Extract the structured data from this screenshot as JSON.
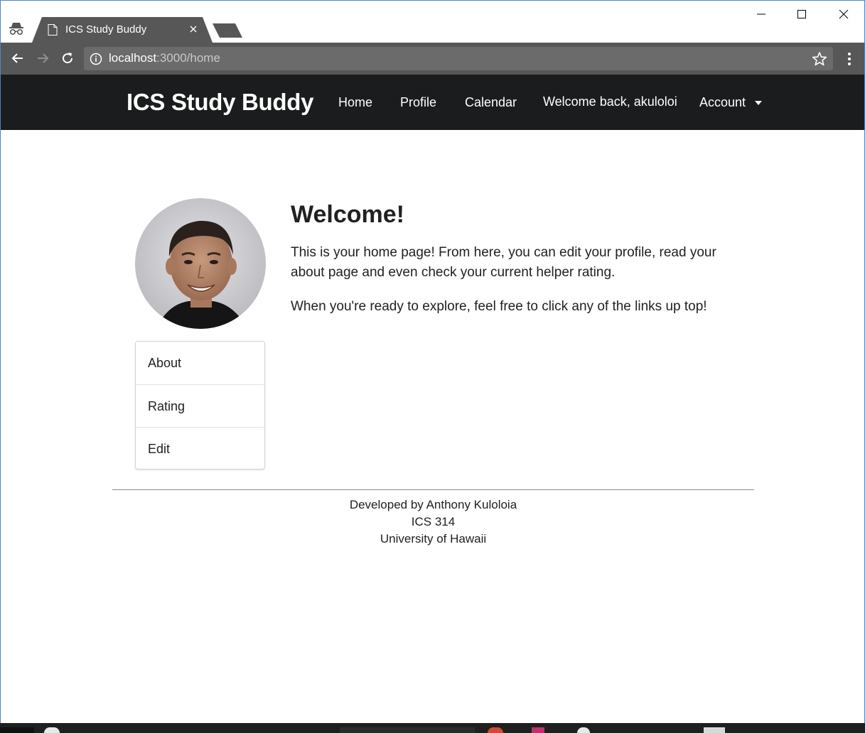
{
  "browser": {
    "tab_title": "ICS Study Buddy",
    "url_host": "localhost",
    "url_path": ":3000/home"
  },
  "navbar": {
    "brand": "ICS Study Buddy",
    "links": [
      "Home",
      "Profile",
      "Calendar",
      "Welcome back, akuloloi",
      "Account"
    ]
  },
  "main": {
    "heading": "Welcome!",
    "paragraph1": "This is your home page! From here, you can edit your profile, read your about page and even check your current helper rating.",
    "paragraph2": "When you're ready to explore, feel free to click any of the links up top!",
    "menu": [
      "About",
      "Rating",
      "Edit"
    ]
  },
  "footer": {
    "line1": "Developed by Anthony Kuloloia",
    "line2": "ICS 314",
    "line3": "University of Hawaii"
  },
  "colors": {
    "navbar_bg": "#1b1c1d",
    "toolbar_bg": "#575757",
    "tab_bg": "#575757"
  }
}
